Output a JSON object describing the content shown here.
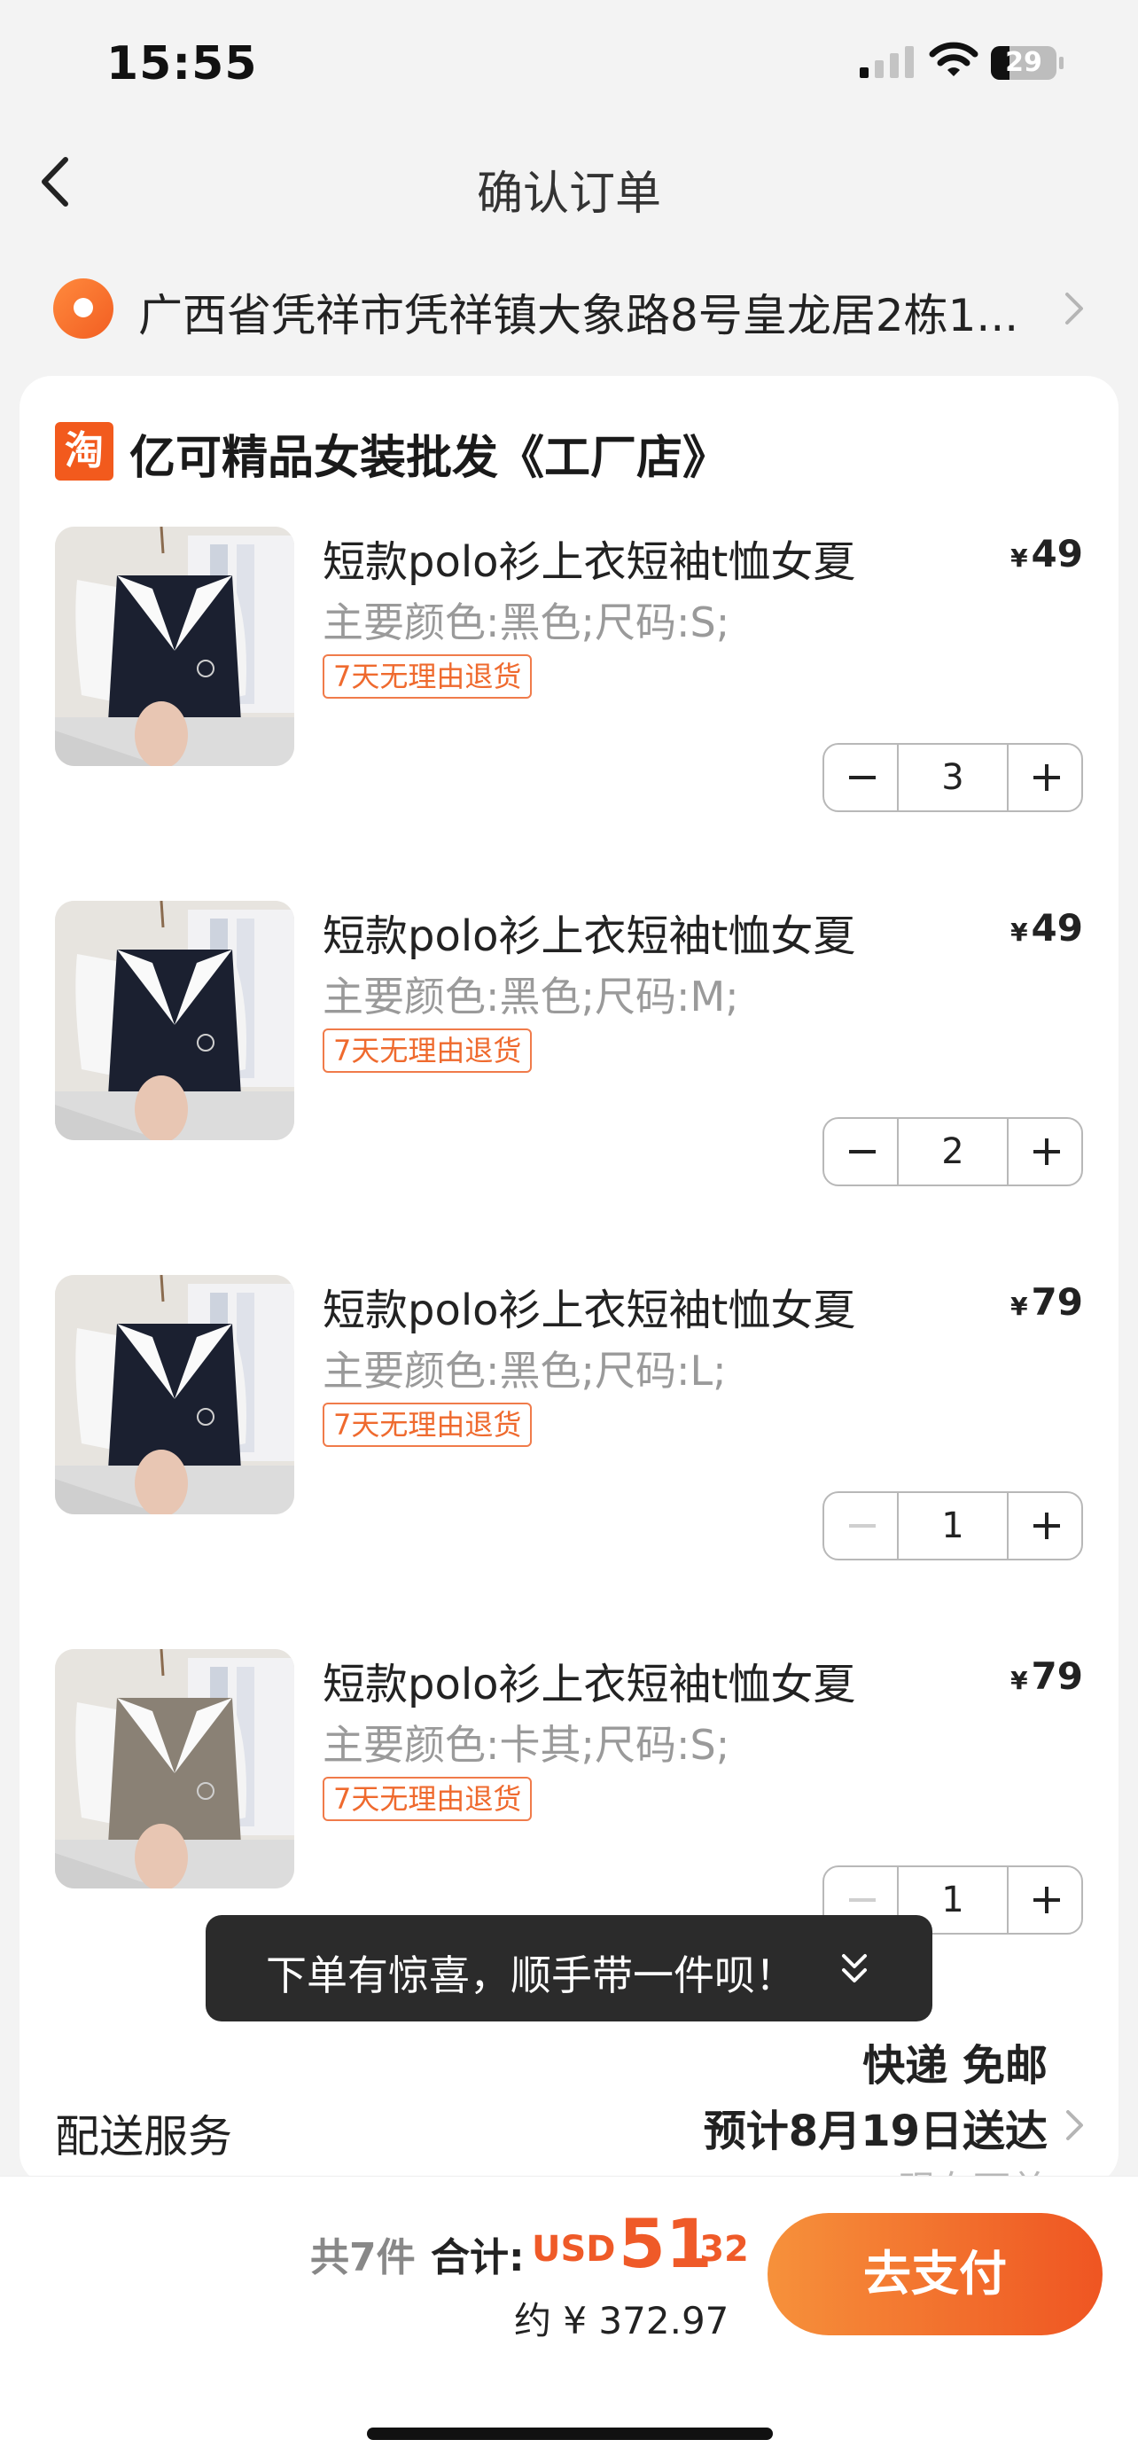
{
  "status_bar": {
    "time": "15:55",
    "battery": "29",
    "battery_level": 0.29
  },
  "nav": {
    "title": "确认订单"
  },
  "address": {
    "text": "广西省凭祥市凭祥镇大象路8号皇龙居2栋1..."
  },
  "shop": {
    "logo": "淘",
    "name": "亿可精品女装批发《工厂店》"
  },
  "items": [
    {
      "title": "短款polo衫上衣短袖t恤女夏",
      "spec": "主要颜色:黑色;尺码:S;",
      "tag": "7天无理由退货",
      "currency": "¥",
      "price": "49",
      "qty": "3",
      "minus_disabled": false,
      "vest_color": "#1b2030"
    },
    {
      "title": "短款polo衫上衣短袖t恤女夏",
      "spec": "主要颜色:黑色;尺码:M;",
      "tag": "7天无理由退货",
      "currency": "¥",
      "price": "49",
      "qty": "2",
      "minus_disabled": false,
      "vest_color": "#1b2030"
    },
    {
      "title": "短款polo衫上衣短袖t恤女夏",
      "spec": "主要颜色:黑色;尺码:L;",
      "tag": "7天无理由退货",
      "currency": "¥",
      "price": "79",
      "qty": "1",
      "minus_disabled": true,
      "vest_color": "#1b2030"
    },
    {
      "title": "短款polo衫上衣短袖t恤女夏",
      "spec": "主要颜色:卡其;尺码:S;",
      "tag": "7天无理由退货",
      "currency": "¥",
      "price": "79",
      "qty": "1",
      "minus_disabled": true,
      "vest_color": "#8a8175"
    }
  ],
  "toast": {
    "text": "下单有惊喜，顺手带一件呗！"
  },
  "delivery": {
    "label": "配送服务",
    "method": "快递 免邮",
    "eta": "预计8月19日送达",
    "peek": "现在下单"
  },
  "summary": {
    "count": "共7件",
    "total_label": "合计:",
    "currency": "USD",
    "total_int": "51",
    "total_dec": ".32",
    "approx": "约 ¥ 372.97"
  },
  "pay_button": {
    "label": "去支付"
  },
  "colors": {
    "accent": "#ef5a28",
    "tag": "#ef6a2e"
  }
}
